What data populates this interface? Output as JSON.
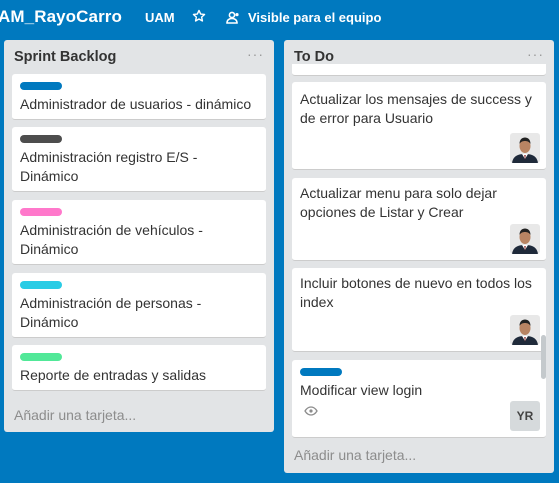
{
  "header": {
    "board_title": "AM_RayoCarro",
    "org": "UAM",
    "visibility": "Visible para el equipo",
    "star_icon": "star-icon",
    "team_icon": "team-icon"
  },
  "lists": {
    "sprint": {
      "title": "Sprint Backlog",
      "menu": "···",
      "add_card": "Añadir una tarjeta...",
      "cards": [
        {
          "label_color": "#0079bf",
          "title": "Administrador de usuarios - dinámico"
        },
        {
          "label_color": "#4d4d4d",
          "title": "Administración registro E/S - Dinámico"
        },
        {
          "label_color": "#ff78cb",
          "title": "Administración de vehículos - Dinámico"
        },
        {
          "label_color": "#29cce5",
          "title": "Administración de personas - Dinámico"
        },
        {
          "label_color": "#51e898",
          "title": "Reporte de entradas y salidas"
        }
      ]
    },
    "todo": {
      "title": "To Do",
      "menu": "···",
      "add_card": "Añadir una tarjeta...",
      "cards": [
        {
          "title": "Actualizar los mensajes de success y de error para Usuario"
        },
        {
          "title": "Actualizar menu para solo dejar opciones de Listar y Crear"
        },
        {
          "title": "Incluir botones de nuevo en todos los index"
        },
        {
          "label_color": "#0079bf",
          "title": "Modificar view login",
          "badge": "eye-icon",
          "member_initials": "YR"
        }
      ]
    }
  }
}
